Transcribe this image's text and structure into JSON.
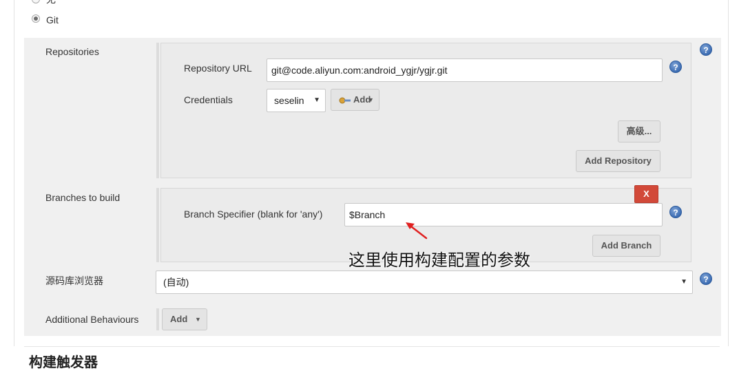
{
  "scm": {
    "option_none_label": "无",
    "option_git_label": "Git",
    "selected": "Git"
  },
  "repositories": {
    "label": "Repositories",
    "url_label": "Repository URL",
    "url_value": "git@code.aliyun.com:android_ygjr/ygjr.git",
    "credentials_label": "Credentials",
    "credentials_value": "seselin",
    "add_credentials_label": "Add",
    "advanced_button": "高级...",
    "add_repository_button": "Add Repository"
  },
  "branches": {
    "label": "Branches to build",
    "delete_button": "X",
    "specifier_label": "Branch Specifier (blank for 'any')",
    "specifier_value": "$Branch",
    "add_branch_button": "Add Branch",
    "annotation": "这里使用构建配置的参数"
  },
  "browser": {
    "label": "源码库浏览器",
    "value": "(自动)"
  },
  "behaviours": {
    "label": "Additional Behaviours",
    "add_button": "Add"
  },
  "next_section_title": "构建触发器",
  "help_icon_glyph": "?",
  "colors": {
    "delete_button": "#d24939",
    "help_icon": "#3d6db3",
    "annotation_arrow": "#e02020"
  }
}
